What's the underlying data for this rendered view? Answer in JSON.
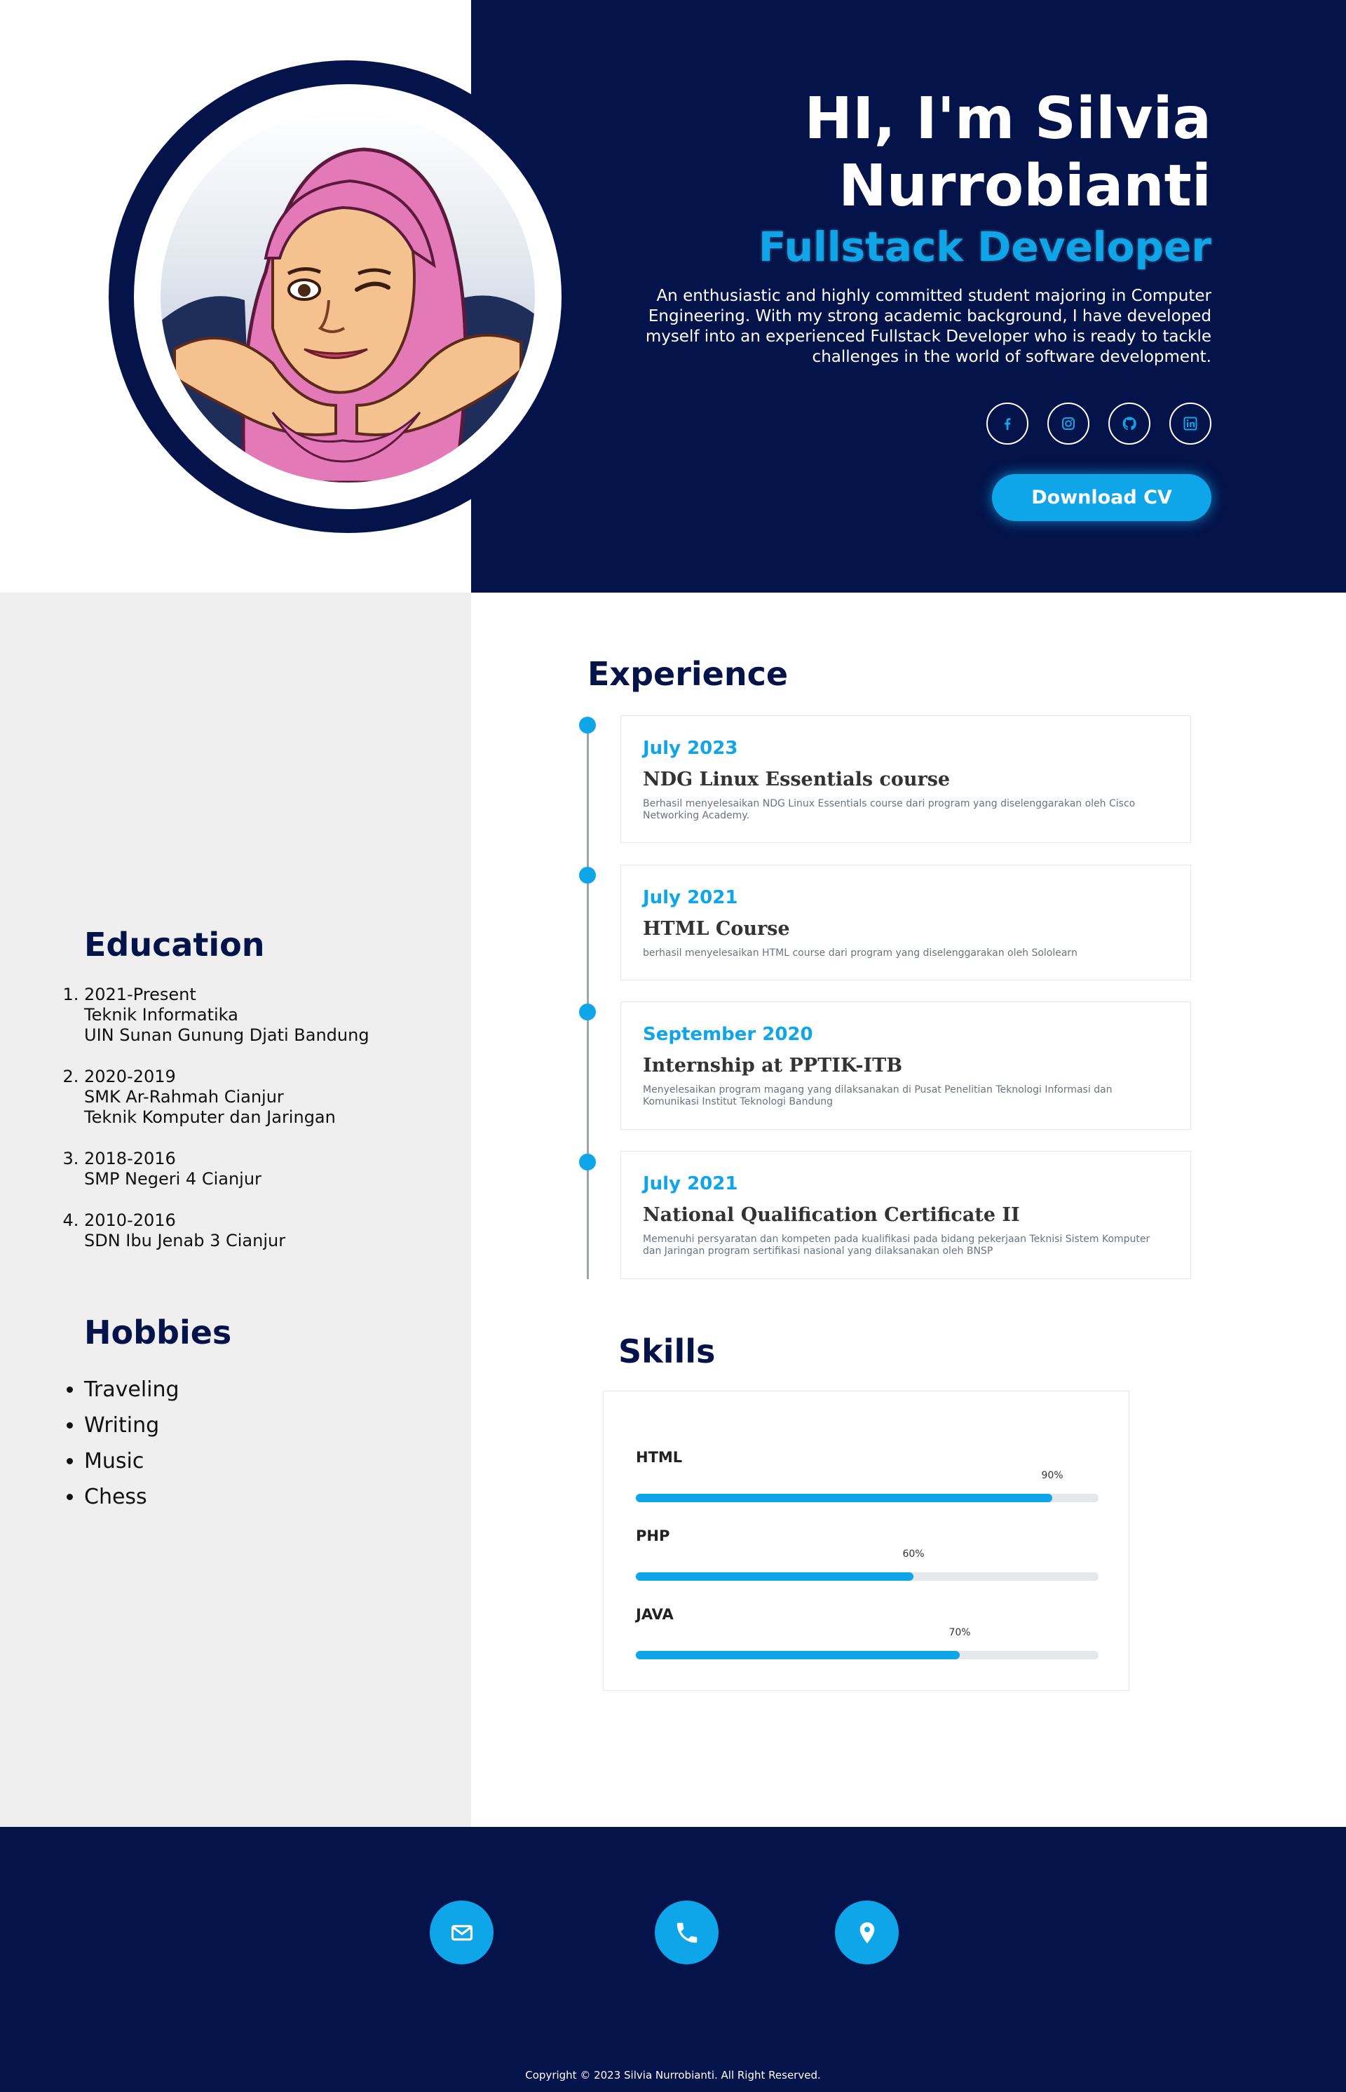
{
  "hero": {
    "name": "HI, I'm Silvia Nurrobianti",
    "role": "Fullstack Developer",
    "description": "An enthusiastic and highly committed student majoring in Computer Engineering. With my strong academic background, I have developed myself into an experienced Fullstack Developer who is ready to tackle challenges in the world of software development.",
    "social_icons": [
      "facebook-icon",
      "instagram-icon",
      "github-icon",
      "linkedin-icon"
    ],
    "cv_button": "Download CV"
  },
  "education": {
    "title": "Education",
    "items": [
      {
        "years": "2021-Present",
        "line1": "Teknik Informatika",
        "line2": "UIN Sunan Gunung Djati Bandung"
      },
      {
        "years": "2020-2019",
        "line1": "SMK Ar-Rahmah Cianjur",
        "line2": "Teknik Komputer dan Jaringan"
      },
      {
        "years": "2018-2016",
        "line1": "SMP Negeri 4 Cianjur",
        "line2": ""
      },
      {
        "years": "2010-2016",
        "line1": "SDN Ibu Jenab 3 Cianjur",
        "line2": ""
      }
    ]
  },
  "hobbies": {
    "title": "Hobbies",
    "items": [
      "Traveling",
      "Writing",
      "Music",
      "Chess"
    ]
  },
  "experience": {
    "title": "Experience",
    "items": [
      {
        "date": "July 2023",
        "name": "NDG Linux Essentials course",
        "desc": "Berhasil menyelesaikan NDG Linux Essentials course dari program yang diselenggarakan oleh Cisco Networking Academy."
      },
      {
        "date": "July 2021",
        "name": "HTML Course",
        "desc": "berhasil menyelesaikan HTML course dari program yang diselenggarakan oleh Sololearn"
      },
      {
        "date": "September 2020",
        "name": "Internship at PPTIK-ITB",
        "desc": "Menyelesaikan program magang yang dilaksanakan di Pusat Penelitian Teknologi Informasi dan Komunikasi Institut Teknologi Bandung"
      },
      {
        "date": "July 2021",
        "name": "National Qualification Certificate II",
        "desc": "Memenuhi persyaratan dan kompeten pada kualifikasi pada bidang pekerjaan Teknisi Sistem Komputer dan Jaringan program sertifikasi nasional yang dilaksanakan oleh BNSP"
      }
    ]
  },
  "skills": {
    "title": "Skills",
    "items": [
      {
        "name": "HTML",
        "percent_label": "90%",
        "level": 0.9
      },
      {
        "name": "PHP",
        "percent_label": "60%",
        "level": 0.6
      },
      {
        "name": "JAVA",
        "percent_label": "70%",
        "level": 0.7
      }
    ]
  },
  "footer": {
    "contact_icons": [
      "email-icon",
      "phone-icon",
      "location-icon"
    ],
    "copyright": "Copyright © 2023 Silvia Nurrobianti. All Right Reserved."
  },
  "colors": {
    "navy": "#04144a",
    "accent": "#0ea5e9",
    "panel": "#efefef"
  }
}
